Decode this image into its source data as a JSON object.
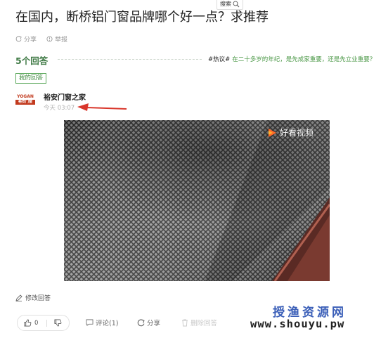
{
  "header": {
    "search_label": "搜索",
    "question_title": "在国内，断桥铝门窗品牌哪个好一点？求推荐",
    "share_label": "分享",
    "report_label": "举报"
  },
  "answers": {
    "count_label": "5个回答",
    "hot_tag": "#热议#",
    "hot_link": "在二十多岁的年纪，是先成家重要，还是先立业重要？",
    "my_answer_label": "我的回答"
  },
  "answer": {
    "avatar_text_top": "YOGAN",
    "avatar_text_bottom": "裕安门窗",
    "author": "裕安门窗之家",
    "time": "今天 03:07",
    "video_brand": "好看视频",
    "edit_label": "修改回答",
    "like_count": "0",
    "comment_label": "评论(1)",
    "share_label": "分享",
    "delete_label": "删除回答"
  },
  "watermark": {
    "line1": "授渔资源网",
    "line2": "www.shouyu.pw"
  },
  "colors": {
    "accent_green": "#3f7a45",
    "annotation_red": "#d9362b",
    "watermark_blue": "#3b5fb8"
  }
}
